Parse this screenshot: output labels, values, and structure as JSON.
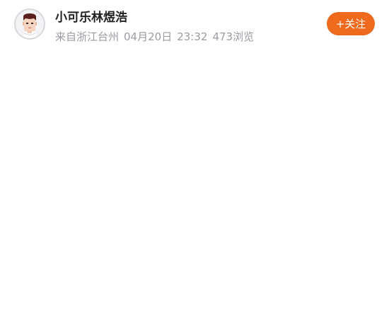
{
  "post": {
    "author": {
      "name": "小可乐林煜浩",
      "avatar_icon": "cartoon-avatar-icon"
    },
    "meta": {
      "source": "来自浙江台州",
      "date": "04月20日",
      "time": "23:32",
      "views": "473浏览"
    },
    "follow_label": "+关注"
  },
  "colors": {
    "accent": "#f06a1d",
    "meta_text": "#9b9ba3",
    "name_text": "#222222"
  }
}
